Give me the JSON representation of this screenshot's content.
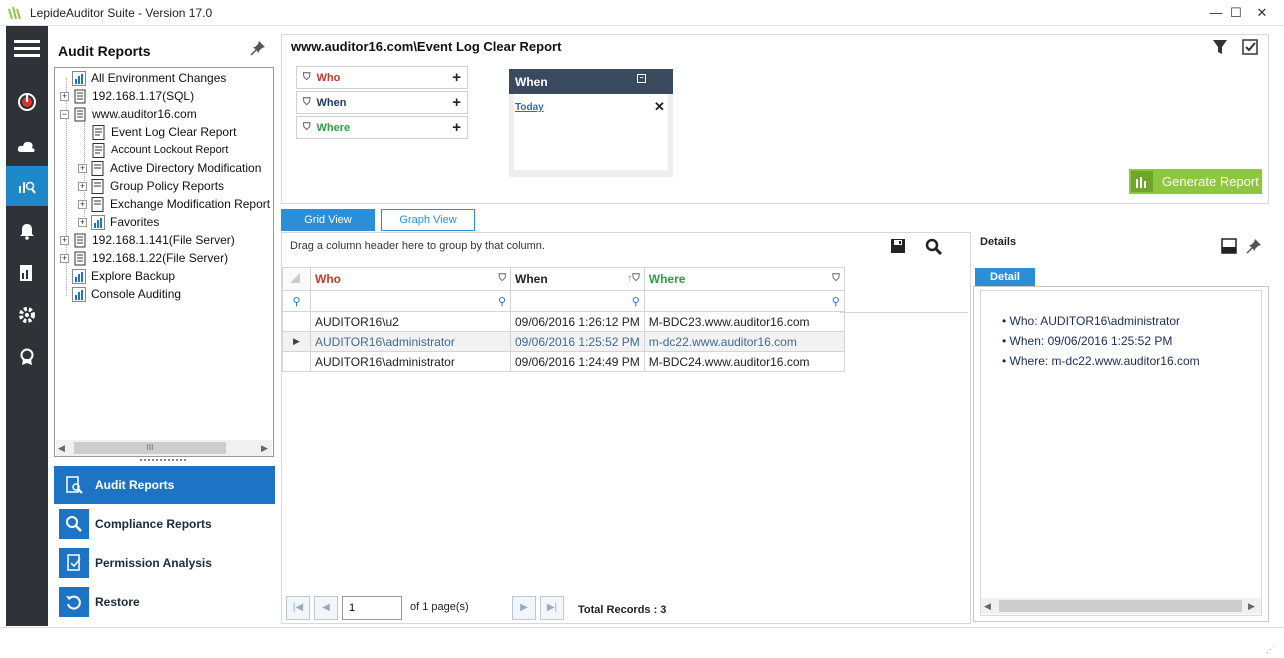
{
  "window": {
    "title": "LepideAuditor Suite - Version 17.0"
  },
  "tree_panel": {
    "title": "Audit Reports",
    "items": [
      {
        "label": "All Environment Changes"
      },
      {
        "label": "192.168.1.17(SQL)"
      },
      {
        "label": "www.auditor16.com"
      },
      {
        "label": "Event Log Clear Report"
      },
      {
        "label": "Account Lockout Report"
      },
      {
        "label": "Active Directory Modification"
      },
      {
        "label": "Group Policy Reports"
      },
      {
        "label": "Exchange Modification Report"
      },
      {
        "label": "Favorites"
      },
      {
        "label": "192.168.1.141(File Server)"
      },
      {
        "label": "192.168.1.22(File Server)"
      },
      {
        "label": "Explore Backup"
      },
      {
        "label": "Console Auditing"
      }
    ],
    "scroll_grip": "III"
  },
  "nav": [
    {
      "label": "Audit Reports"
    },
    {
      "label": "Compliance Reports"
    },
    {
      "label": "Permission Analysis"
    },
    {
      "label": "Restore"
    }
  ],
  "report": {
    "title": "www.auditor16.com\\Event Log Clear Report",
    "filters": [
      {
        "label": "Who",
        "color": "#c0392b"
      },
      {
        "label": "When",
        "color": "#1b3a5c"
      },
      {
        "label": "Where",
        "color": "#2e9e3f"
      }
    ],
    "when_panel": {
      "title": "When",
      "value": "Today"
    },
    "generate_label": "Generate Report"
  },
  "tabs": {
    "grid": "Grid View",
    "graph": "Graph View"
  },
  "grid": {
    "drag_hint": "Drag a column header here to group by that column.",
    "columns": [
      {
        "label": "Who",
        "color": "#c0392b"
      },
      {
        "label": "When",
        "color": "#222222"
      },
      {
        "label": "Where",
        "color": "#2e9e3f"
      }
    ],
    "rows": [
      {
        "who": "AUDITOR16\\u2",
        "when": "09/06/2016 1:26:12 PM",
        "where": "M-BDC23.www.auditor16.com"
      },
      {
        "who": "AUDITOR16\\administrator",
        "when": "09/06/2016 1:25:52 PM",
        "where": "m-dc22.www.auditor16.com"
      },
      {
        "who": "AUDITOR16\\administrator",
        "when": "09/06/2016 1:24:49 PM",
        "where": "M-BDC24.www.auditor16.com"
      }
    ]
  },
  "details": {
    "title": "Details",
    "tab": "Detail",
    "lines": [
      "Who:  AUDITOR16\\administrator",
      "When:  09/06/2016 1:25:52 PM",
      "Where:  m-dc22.www.auditor16.com"
    ]
  },
  "pager": {
    "page": "1",
    "of_text": "of 1 page(s)",
    "total": "Total Records : 3"
  },
  "colors": {
    "accent": "#1e74c4",
    "rail": "#2f3237",
    "generate": "#8dc63f"
  }
}
